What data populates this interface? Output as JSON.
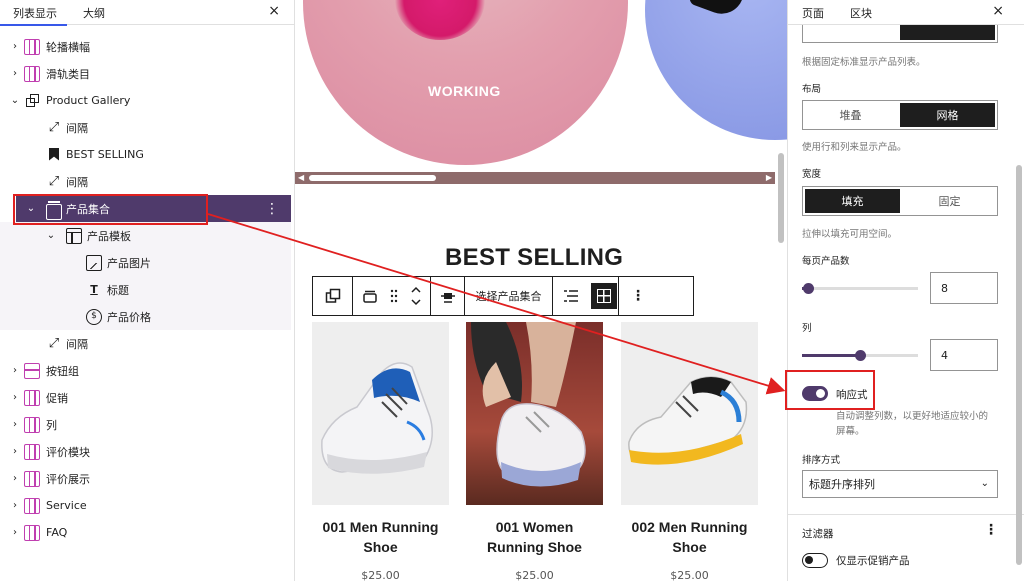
{
  "left_panel": {
    "tabs": [
      "列表显示",
      "大纲"
    ],
    "close": "×",
    "items": [
      {
        "label": "轮播横幅",
        "icon": "columns-icon",
        "expandable": true
      },
      {
        "label": "滑轨类目",
        "icon": "columns-icon",
        "expandable": true
      },
      {
        "label": "Product Gallery",
        "icon": "group-icon",
        "expanded": true
      },
      {
        "label": "间隔",
        "icon": "spacer-icon"
      },
      {
        "label": "BEST SELLING",
        "icon": "bookmark-icon"
      },
      {
        "label": "间隔",
        "icon": "spacer-icon"
      },
      {
        "label": "产品集合",
        "icon": "product-collection-icon",
        "expanded": true,
        "selected": true
      },
      {
        "label": "产品模板",
        "icon": "template-icon",
        "expanded": true
      },
      {
        "label": "产品图片",
        "icon": "image-icon"
      },
      {
        "label": "标题",
        "icon": "title-icon"
      },
      {
        "label": "产品价格",
        "icon": "price-icon"
      },
      {
        "label": "间隔",
        "icon": "spacer-icon"
      },
      {
        "label": "按钮组",
        "icon": "buttons-icon",
        "expandable": true
      },
      {
        "label": "促销",
        "icon": "columns-icon",
        "expandable": true
      },
      {
        "label": "列",
        "icon": "columns-icon",
        "expandable": true
      },
      {
        "label": "评价模块",
        "icon": "columns-icon",
        "expandable": true
      },
      {
        "label": "评价展示",
        "icon": "columns-icon",
        "expandable": true
      },
      {
        "label": "Service",
        "icon": "columns-icon",
        "expandable": true
      },
      {
        "label": "FAQ",
        "icon": "columns-icon",
        "expandable": true
      }
    ]
  },
  "canvas": {
    "hero_label": "WORKING",
    "section_title": "BEST SELLING",
    "toolbar": {
      "choose_collection": "选择产品集合"
    },
    "products": [
      {
        "name": "001 Men Running Shoe",
        "price": "$25.00"
      },
      {
        "name": "001 Women Running Shoe",
        "price": "$25.00"
      },
      {
        "name": "002 Men Running Shoe",
        "price": "$25.00"
      }
    ]
  },
  "right_panel": {
    "tabs": [
      "页面",
      "区块"
    ],
    "close": "×",
    "query_help": "根据固定标准显示产品列表。",
    "layout": {
      "label": "布局",
      "options": [
        "堆叠",
        "网格"
      ],
      "selected": "网格",
      "help": "使用行和列来显示产品。"
    },
    "width": {
      "label": "宽度",
      "options": [
        "填充",
        "固定"
      ],
      "selected": "填充",
      "help": "拉伸以填充可用空间。"
    },
    "per_page": {
      "label": "每页产品数",
      "value": "8",
      "fraction": 0.05
    },
    "columns": {
      "label": "列",
      "value": "4",
      "fraction": 0.5
    },
    "responsive": {
      "label": "响应式",
      "on": true,
      "help_line1": "自动调整列数，以更好地适应较小的",
      "help_line2": "屏幕。"
    },
    "order": {
      "label": "排序方式",
      "value": "标题升序排列"
    },
    "filters": {
      "label": "过滤器",
      "on_sale_label": "仅显示促销产品",
      "on_sale": false
    }
  },
  "colors": {
    "accent": "#4f3a6b",
    "annotation": "#e02020"
  }
}
